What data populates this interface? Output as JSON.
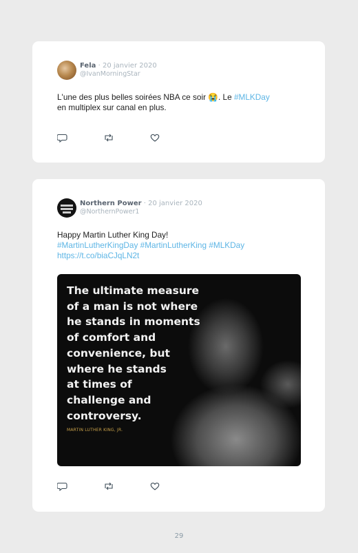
{
  "tweets": [
    {
      "author": "Fela",
      "separator": "·",
      "date": "20 janvier 2020",
      "handle": "@IvanMorningStar",
      "text_before": "L'une des plus belles soirées NBA ce soir 😭. Le ",
      "hashtag": "#MLKDay",
      "text_after": "en multiplex sur canal en plus."
    },
    {
      "author": "Northern Power",
      "separator": "·",
      "date": "20 janvier 2020",
      "handle": "@NorthernPower1",
      "line1": "Happy Martin Luther King Day!",
      "hashtags": "#MartinLutherKingDay #MartinLutherKing #MLKDay",
      "url": "https://t.co/biaCJqLN2t",
      "image_quote": "The ultimate measure\nof a man is not where\nhe stands in moments\nof comfort and\nconvenience, but\nwhere he stands\nat times of\nchallenge and\ncontroversy.",
      "image_attribution": "MARTIN LUTHER KING, JR."
    }
  ],
  "icons": {
    "reply": "reply-icon",
    "retweet": "retweet-icon",
    "like": "heart-icon"
  },
  "colors": {
    "link": "#5db5e5",
    "name": "#5a6470",
    "muted": "#a9b4bd",
    "background": "#ebebeb"
  },
  "page_number": "29"
}
